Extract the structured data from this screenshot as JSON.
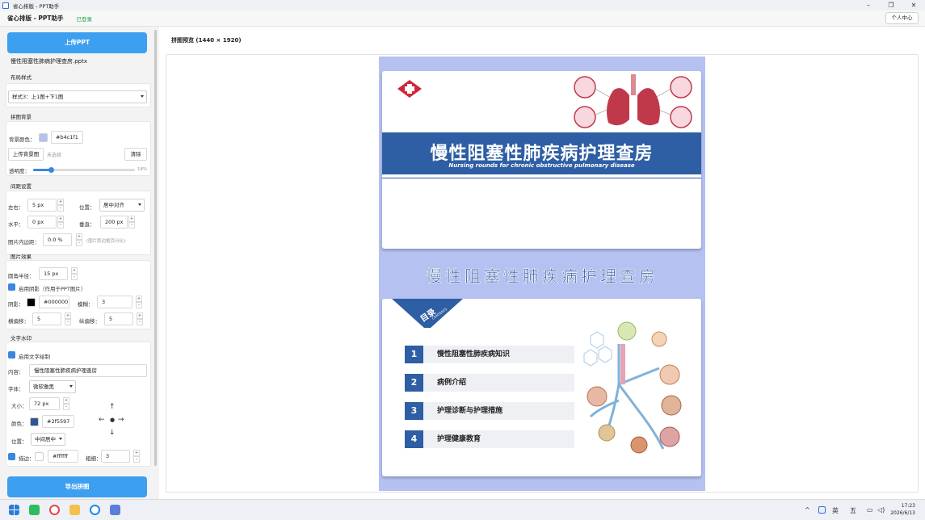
{
  "window": {
    "title": "省心排版 - PPT助手"
  },
  "app": {
    "name": "省心排版 - PPT助手",
    "status": "已登录",
    "user_button": "个人中心"
  },
  "sidebar": {
    "upload_button": "上传PPT",
    "file_name": "慢性阻塞性肺病护理查房.pptx",
    "layout": {
      "title": "布局样式",
      "value": "样式3：上1图+下1图"
    },
    "background": {
      "title": "拼图背景",
      "color_label": "背景颜色：",
      "color_value": "#b4c1f1",
      "upload_label": "上传背景图",
      "upload_state": "未选择",
      "clear_label": "清除",
      "opacity_label": "透明度：",
      "opacity_value": "18%",
      "opacity": 0.18
    },
    "spacing": {
      "title": "间距设置",
      "lr_label": "左右：",
      "lr_value": "5 px",
      "pos_label": "位置：",
      "pos_value": "居中对齐",
      "h_label": "水平：",
      "h_value": "0 px",
      "v_label": "垂直：",
      "v_value": "200 px",
      "pad_label": "图片内边距：",
      "pad_value": "0.0 %",
      "pad_hint": "(图片距边框百分比)"
    },
    "effects": {
      "title": "图片效果",
      "radius_label": "圆角半径：",
      "radius_value": "15 px",
      "shadow_label": "启用阴影（作用于PPT图片）",
      "shadow_color_label": "阴影：",
      "shadow_color_value": "#000000",
      "blur_label": "模糊：",
      "blur_value": "3",
      "hoff_label": "横偏移：",
      "hoff_value": "5",
      "voff_label": "纵偏移：",
      "voff_value": "5"
    },
    "watermark": {
      "title": "文字水印",
      "enable_label": "启用文字绘制",
      "content_label": "内容：",
      "content_value": "慢性阻塞性肺疾病护理查房",
      "font_label": "字体：",
      "font_value": "微软雅黑",
      "size_label": "大小：",
      "size_value": "72 px",
      "color_label": "颜色：",
      "color_value": "#2f5597",
      "pos_label": "位置：",
      "pos_value": "中间居中",
      "stroke_label": "描边：",
      "stroke_color": "#ffffff",
      "thick_label": "粗细：",
      "thick_value": "3"
    },
    "export_button": "导出拼图"
  },
  "preview": {
    "title": "拼图预览 (1440 × 1920)",
    "slide1": {
      "title": "慢性阻塞性肺疾病护理查房",
      "subtitle": "Nursing rounds for chronic obstructive pulmonary disease"
    },
    "watermark_text": "慢性阻塞性肺疾病护理查房",
    "slide2": {
      "toc_title": "目录",
      "toc_sub": "CONTENTS",
      "items": [
        {
          "num": "1",
          "label": "慢性阻塞性肺疾病知识"
        },
        {
          "num": "2",
          "label": "病例介绍"
        },
        {
          "num": "3",
          "label": "护理诊断与护理措施"
        },
        {
          "num": "4",
          "label": "护理健康教育"
        }
      ]
    }
  },
  "taskbar": {
    "ime1": "英",
    "ime2": "五",
    "time": "17:23",
    "date": "2026/6/13"
  },
  "colors": {
    "accent": "#3d9ff0",
    "banner": "#2e5ea3",
    "bg": "#b4c1f1",
    "watermark": "#2f5597"
  }
}
